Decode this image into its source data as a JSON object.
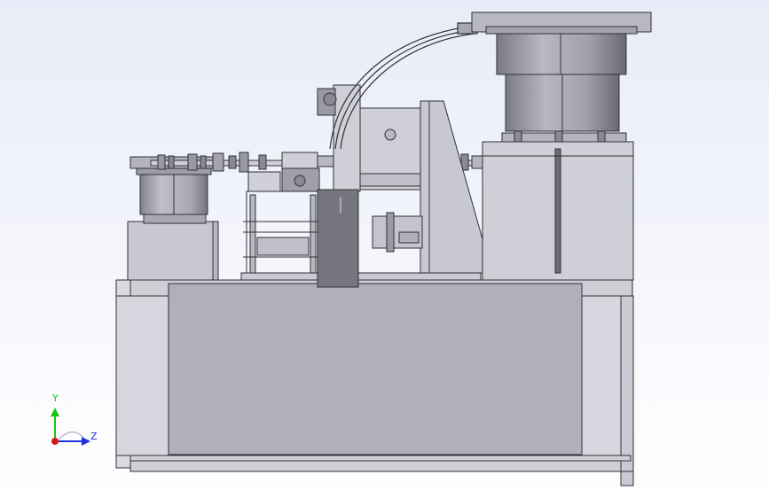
{
  "viewport": {
    "background_top": "#e9ecf8",
    "background_bottom": "#ffffff",
    "body_color": "#c6c6d0",
    "line_color": "#303036"
  },
  "triad": {
    "y_label": "Y",
    "z_label": "Z",
    "y_color": "#18c418",
    "z_color": "#1f33d8",
    "x_color": "#d81818",
    "icon": "coordinate-triad-icon"
  }
}
